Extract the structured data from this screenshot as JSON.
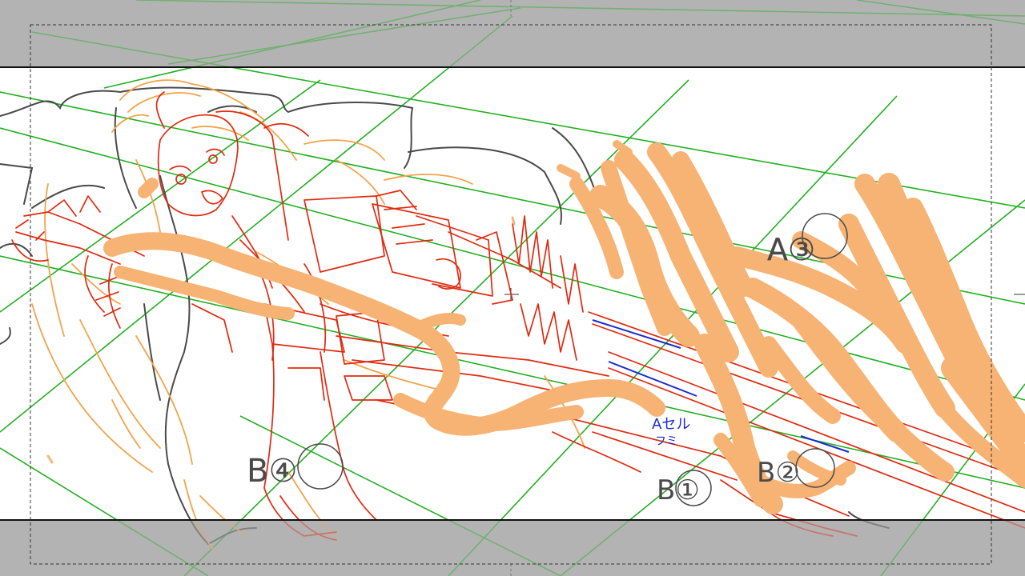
{
  "colors": {
    "pasteboard": "#b3b3b3",
    "frame": "#ffffff",
    "frame_border": "#111111",
    "safe_area": "#333333",
    "perspective_grid": "#22b022",
    "guide_red": "#e02a10",
    "guide_orange": "#f3a34a",
    "sketch_gray": "#4a4a4a",
    "effect_fill": "#f7b374",
    "note_blue": "#1a2acc"
  },
  "canvas": {
    "annotations": {
      "cut_a": "A③",
      "cut_b_left": "B④",
      "cut_b_right": "B①",
      "cut_b_right2": "B②",
      "note_line1": "Aセル",
      "note_line2": "フミ"
    }
  }
}
